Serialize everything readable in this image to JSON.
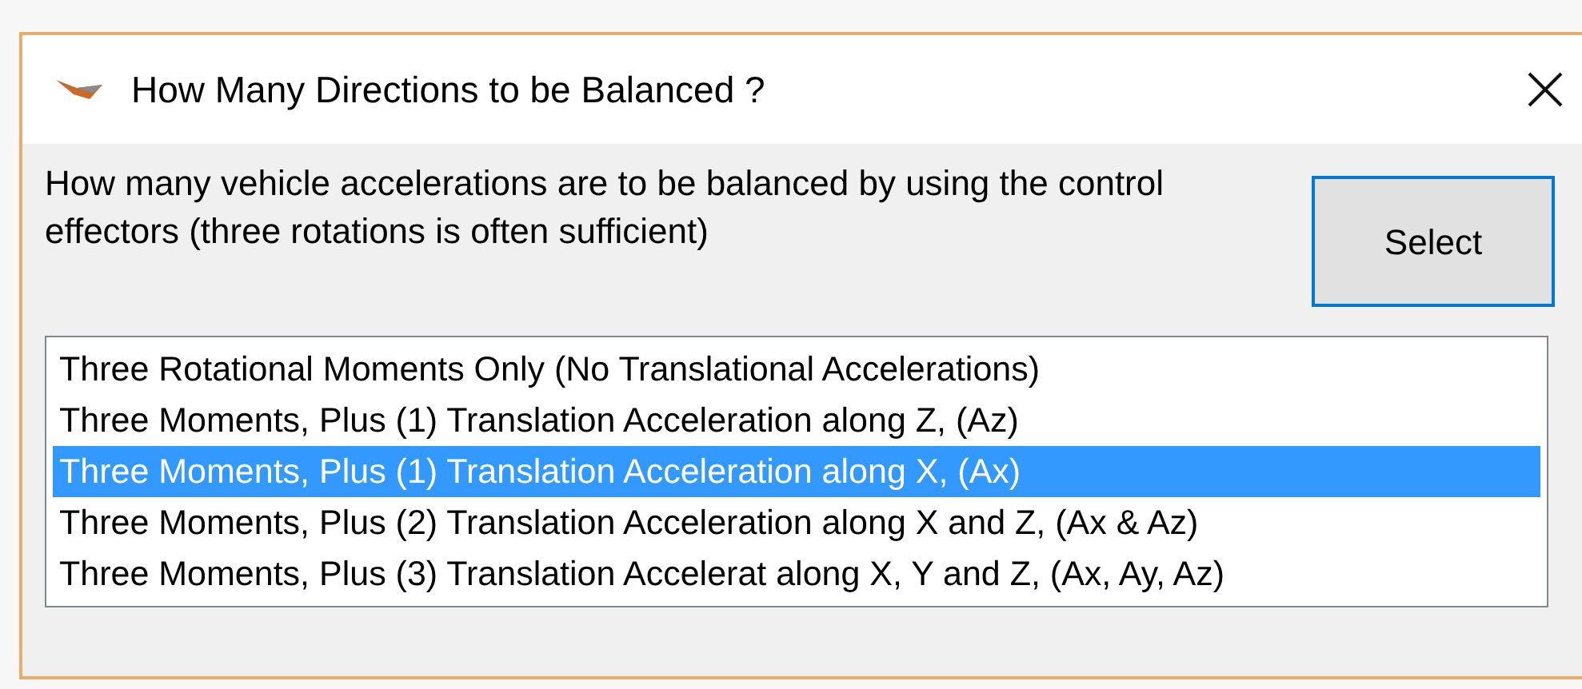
{
  "window": {
    "title": "How Many Directions to be Balanced ?"
  },
  "prompt": "How many vehicle accelerations are to be balanced by using the control effectors (three rotations is often sufficient)",
  "select_button": {
    "label": "Select",
    "focused": true
  },
  "options": [
    {
      "label": "Three Rotational Moments Only (No Translational Accelerations)",
      "selected": false
    },
    {
      "label": "Three Moments, Plus (1) Translation Acceleration along Z, (Az)",
      "selected": false
    },
    {
      "label": "Three Moments, Plus (1) Translation Acceleration along X, (Ax)",
      "selected": true
    },
    {
      "label": "Three Moments, Plus (2) Translation Acceleration along X and Z, (Ax & Az)",
      "selected": false
    },
    {
      "label": "Three Moments, Plus (3) Translation Accelerat along X, Y and Z, (Ax, Ay, Az)",
      "selected": false
    }
  ]
}
